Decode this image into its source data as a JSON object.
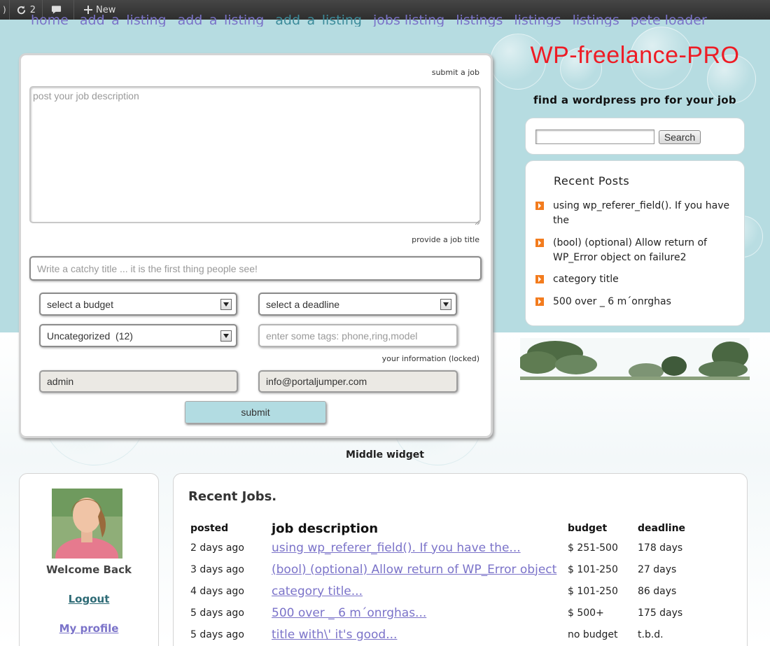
{
  "adminbar": {
    "items": [
      {
        "icon": "info-icon",
        "label": ""
      },
      {
        "icon": "refresh-icon",
        "label": "2"
      },
      {
        "icon": "comment-icon",
        "label": ""
      },
      {
        "icon": "plus-icon",
        "label": "New"
      }
    ]
  },
  "nav": {
    "items": [
      "home",
      "add_a_listing",
      "add_a_listing",
      "add_a_listing",
      "jobs listing",
      "listings",
      "listings",
      "listings",
      "pete loader"
    ]
  },
  "form": {
    "submit_job_label": "submit a job",
    "description_placeholder": "post your job description",
    "title_label": "provide a job title",
    "title_placeholder": "Write a catchy title ... it is the first thing people see!",
    "budget_select": "select a budget",
    "deadline_select": "select a deadline",
    "category_select": "Uncategorized  (12)",
    "tags_placeholder": "enter some tags: phone,ring,model",
    "info_label": "your information (locked)",
    "username": "admin",
    "email": "info@portaljumper.com",
    "submit_label": "submit"
  },
  "site": {
    "title": "WP-freelance-PRO",
    "tagline": "find a wordpress pro for your job",
    "accent_color": "#ee1c25"
  },
  "search": {
    "button_label": "Search"
  },
  "recent_posts": {
    "title": "Recent Posts",
    "items": [
      "using wp_referer_field(). If you have the",
      "(bool) (optional) Allow return of WP_Error object on failure2",
      "category title",
      "500 over _ 6 m´onrghas"
    ]
  },
  "middle_widget": {
    "title": "Middle widget"
  },
  "profile": {
    "welcome": "Welcome Back",
    "logout": "Logout",
    "my_profile": "My profile"
  },
  "jobs": {
    "title": "Recent Jobs.",
    "headers": {
      "posted": "posted",
      "description": "job description",
      "budget": "budget",
      "deadline": "deadline"
    },
    "rows": [
      {
        "posted": "2 days ago",
        "description": "using wp_referer_field(). If you have the...",
        "budget": "$ 251-500",
        "deadline": "178 days"
      },
      {
        "posted": "3 days ago",
        "description": "(bool) (optional) Allow return of WP_Error object",
        "budget": "$ 101-250",
        "deadline": "27 days"
      },
      {
        "posted": "4 days ago",
        "description": "category title...",
        "budget": "$ 101-250",
        "deadline": "86 days"
      },
      {
        "posted": "5 days ago",
        "description": "500 over _ 6 m´onrghas...",
        "budget": "$ 500+",
        "deadline": "175 days"
      },
      {
        "posted": "5 days ago",
        "description": "title with\\' it's good...",
        "budget": "no budget",
        "deadline": "t.b.d."
      }
    ]
  }
}
